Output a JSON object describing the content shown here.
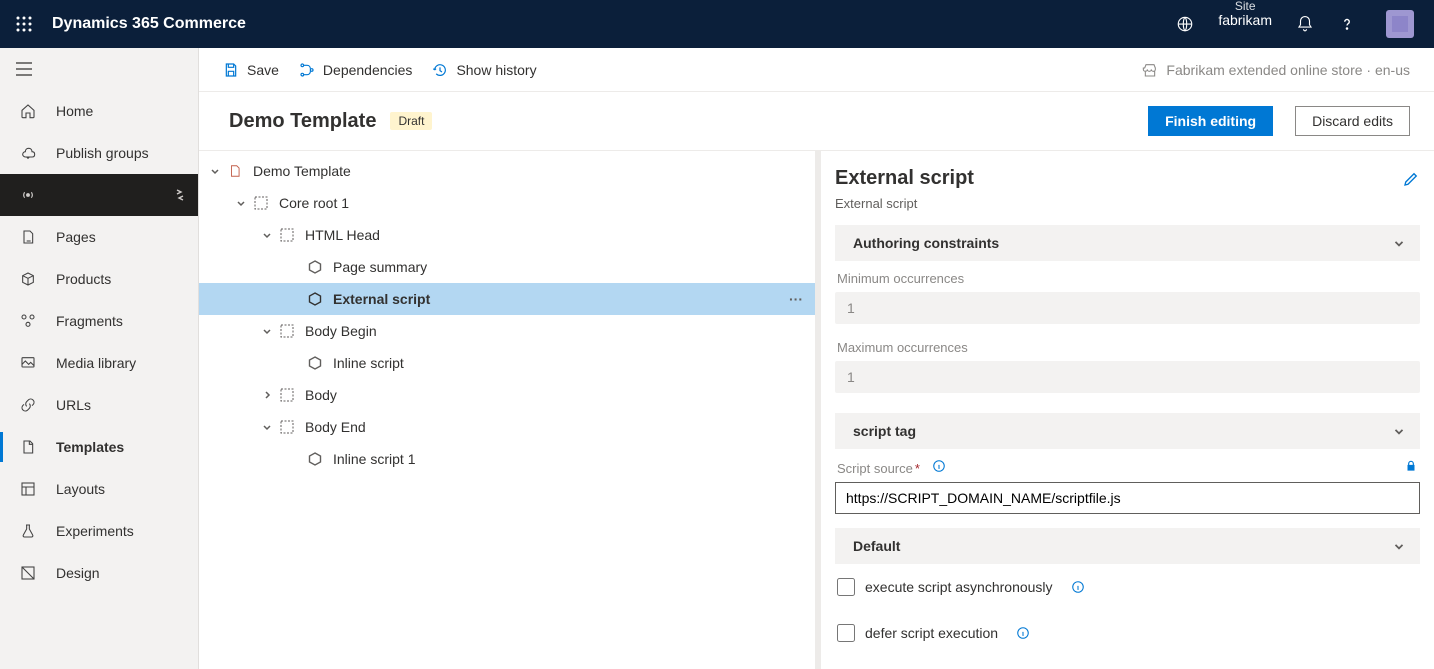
{
  "header": {
    "brand": "Dynamics 365 Commerce",
    "site_label": "Site",
    "site_name": "fabrikam"
  },
  "sidebar": {
    "items": [
      {
        "label": "Home"
      },
      {
        "label": "Publish groups"
      },
      {
        "label": ""
      },
      {
        "label": "Pages"
      },
      {
        "label": "Products"
      },
      {
        "label": "Fragments"
      },
      {
        "label": "Media library"
      },
      {
        "label": "URLs"
      },
      {
        "label": "Templates"
      },
      {
        "label": "Layouts"
      },
      {
        "label": "Experiments"
      },
      {
        "label": "Design"
      }
    ]
  },
  "commands": {
    "save": "Save",
    "dependencies": "Dependencies",
    "history": "Show history",
    "channel": "Fabrikam extended online store · en-us"
  },
  "page": {
    "title": "Demo Template",
    "status": "Draft",
    "finish": "Finish editing",
    "discard": "Discard edits"
  },
  "tree": {
    "root": "Demo Template",
    "core": "Core root 1",
    "html_head": "HTML Head",
    "page_summary": "Page summary",
    "external_script": "External script",
    "body_begin": "Body Begin",
    "inline_script": "Inline script",
    "body": "Body",
    "body_end": "Body End",
    "inline_script_1": "Inline script 1"
  },
  "props": {
    "title": "External script",
    "subtitle": "External script",
    "section_authoring": "Authoring constraints",
    "min_label": "Minimum occurrences",
    "min_value": "1",
    "max_label": "Maximum occurrences",
    "max_value": "1",
    "section_script": "script tag",
    "source_label": "Script source",
    "source_value": "https://SCRIPT_DOMAIN_NAME/scriptfile.js",
    "section_default": "Default",
    "async_label": "execute script asynchronously",
    "defer_label": "defer script execution"
  }
}
